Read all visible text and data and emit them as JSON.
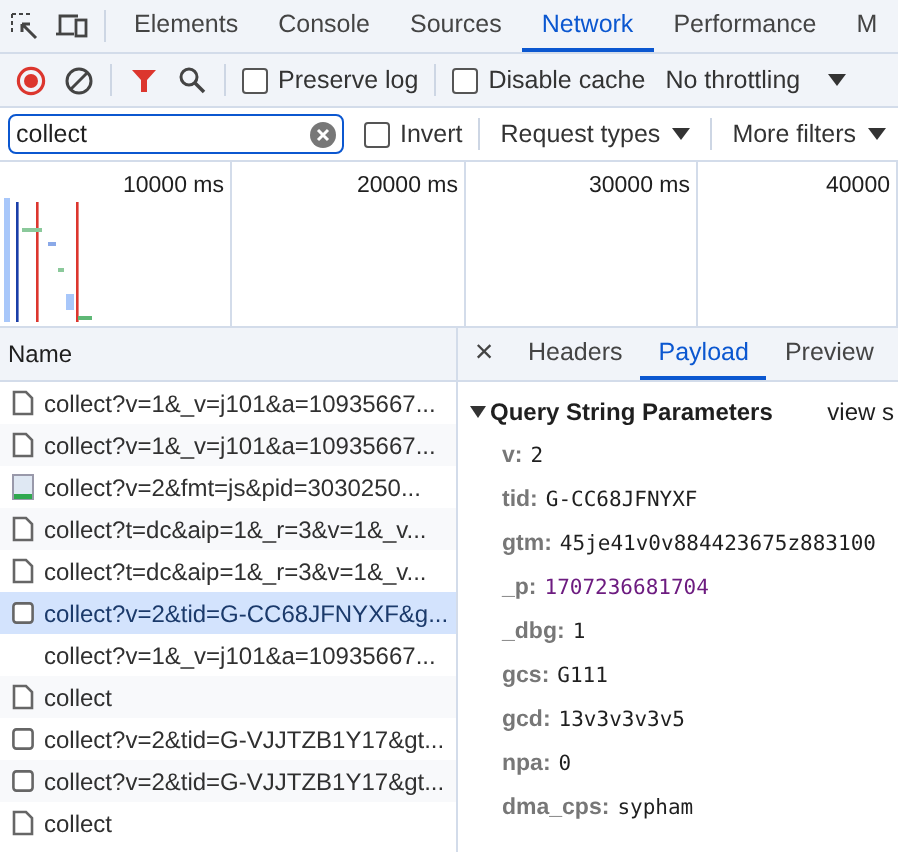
{
  "main_tabs": [
    {
      "label": "Elements",
      "selected": false
    },
    {
      "label": "Console",
      "selected": false
    },
    {
      "label": "Sources",
      "selected": false
    },
    {
      "label": "Network",
      "selected": true
    },
    {
      "label": "Performance",
      "selected": false
    },
    {
      "label": "M",
      "selected": false
    }
  ],
  "toolbar": {
    "recording": true,
    "preserve_log": {
      "label": "Preserve log",
      "checked": false
    },
    "disable_cache": {
      "label": "Disable cache",
      "checked": false
    },
    "throttling": "No throttling"
  },
  "filter": {
    "value": "collect",
    "invert": {
      "label": "Invert",
      "checked": false
    },
    "request_types": "Request types",
    "more_filters": "More filters"
  },
  "timeline": {
    "ticks": [
      "10000 ms",
      "20000 ms",
      "30000 ms",
      "40000"
    ]
  },
  "requests": {
    "column": "Name",
    "rows": [
      {
        "name": "collect?v=1&_v=j101&a=10935667...",
        "kind": "document",
        "selected": false
      },
      {
        "name": "collect?v=1&_v=j101&a=10935667...",
        "kind": "document",
        "selected": false
      },
      {
        "name": "collect?v=2&fmt=js&pid=3030250...",
        "kind": "image",
        "selected": false
      },
      {
        "name": "collect?t=dc&aip=1&_r=3&v=1&_v...",
        "kind": "document",
        "selected": false
      },
      {
        "name": "collect?t=dc&aip=1&_r=3&v=1&_v...",
        "kind": "document",
        "selected": false
      },
      {
        "name": "collect?v=2&tid=G-CC68JFNYXF&g...",
        "kind": "fetch",
        "selected": true
      },
      {
        "name": "collect?v=1&_v=j101&a=10935667...",
        "kind": "none",
        "selected": false
      },
      {
        "name": "collect",
        "kind": "document",
        "selected": false
      },
      {
        "name": "collect?v=2&tid=G-VJJTZB1Y17&gt...",
        "kind": "fetch",
        "selected": false
      },
      {
        "name": "collect?v=2&tid=G-VJJTZB1Y17&gt...",
        "kind": "fetch",
        "selected": false
      },
      {
        "name": "collect",
        "kind": "document",
        "selected": false
      }
    ]
  },
  "detail": {
    "close": "×",
    "tabs": [
      {
        "label": "Headers",
        "selected": false
      },
      {
        "label": "Payload",
        "selected": true
      },
      {
        "label": "Preview",
        "selected": false
      }
    ],
    "section": {
      "title": "Query String Parameters",
      "expanded": true,
      "view_source": "view s"
    },
    "params": [
      {
        "key": "v:",
        "value": "2",
        "kind": "text"
      },
      {
        "key": "tid:",
        "value": "G-CC68JFNYXF",
        "kind": "text"
      },
      {
        "key": "gtm:",
        "value": "45je41v0v884423675z883100",
        "kind": "text"
      },
      {
        "key": "_p:",
        "value": "1707236681704",
        "kind": "number"
      },
      {
        "key": "_dbg:",
        "value": "1",
        "kind": "text"
      },
      {
        "key": "gcs:",
        "value": "G111",
        "kind": "text"
      },
      {
        "key": "gcd:",
        "value": "13v3v3v3v5",
        "kind": "text"
      },
      {
        "key": "npa:",
        "value": "0",
        "kind": "text"
      },
      {
        "key": "dma_cps:",
        "value": "sypham",
        "kind": "text"
      }
    ]
  }
}
